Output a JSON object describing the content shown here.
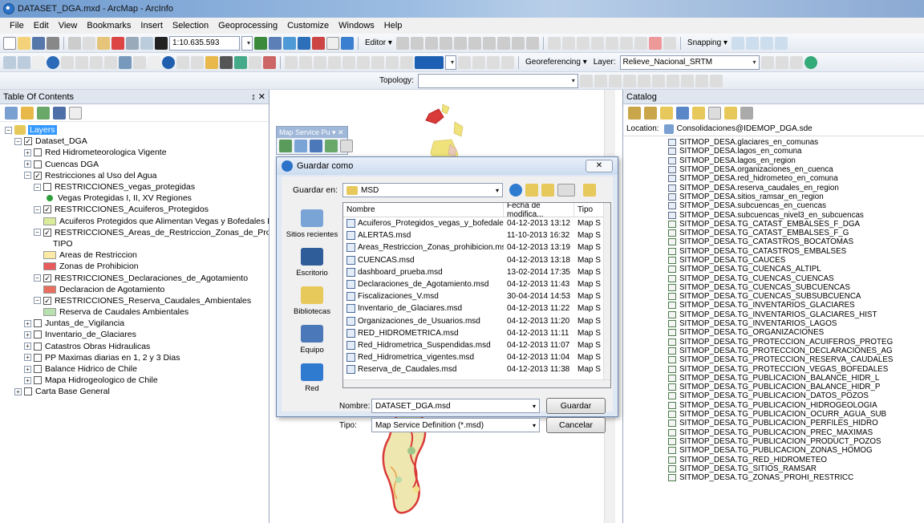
{
  "window": {
    "title": "DATASET_DGA.mxd - ArcMap - ArcInfo"
  },
  "menu": [
    "File",
    "Edit",
    "View",
    "Bookmarks",
    "Insert",
    "Selection",
    "Geoprocessing",
    "Customize",
    "Windows",
    "Help"
  ],
  "toolbar": {
    "scale": "1:10.635.593",
    "editor_label": "Editor ▾",
    "snapping_label": "Snapping ▾",
    "georef_label": "Georeferencing ▾",
    "layer_label": "Layer:",
    "layer_value": "Relieve_Nacional_SRTM",
    "topology_label": "Topology:"
  },
  "toc": {
    "title": "Table Of Contents",
    "pin": "↕ ✕",
    "rows": [
      {
        "indent": 0,
        "exp": "−",
        "check": null,
        "text": "Layers",
        "hl": true
      },
      {
        "indent": 1,
        "exp": "−",
        "check": "✓",
        "text": "Dataset_DGA"
      },
      {
        "indent": 2,
        "exp": "+",
        "check": "",
        "text": "Red Hidrometeorologica Vigente"
      },
      {
        "indent": 2,
        "exp": "+",
        "check": "",
        "text": "Cuencas DGA"
      },
      {
        "indent": 2,
        "exp": "−",
        "check": "✓",
        "text": "Restricciones al Uso del Agua"
      },
      {
        "indent": 3,
        "exp": "−",
        "check": "",
        "text": "RESTRICCIONES_vegas_protegidas"
      },
      {
        "indent": 4,
        "sym": "#2e9e3a",
        "text": "Vegas Protegidas I, II, XV Regiones",
        "dot": true
      },
      {
        "indent": 3,
        "exp": "−",
        "check": "✓",
        "text": "RESTRICCIONES_Acuiferos_Protegidos"
      },
      {
        "indent": 4,
        "sym": "#d9ec9a",
        "text": "Acuiferos Protegidos que Alimentan Vegas y Bofedales I, I"
      },
      {
        "indent": 3,
        "exp": "−",
        "check": "✓",
        "text": "RESTRICCIONES_Areas_de_Restriccion_Zonas_de_Prohibicion"
      },
      {
        "indent": 5,
        "text": "TIPO"
      },
      {
        "indent": 4,
        "sym": "#fbe9a6",
        "text": "Areas de Restriccion"
      },
      {
        "indent": 4,
        "sym": "#e85b5b",
        "text": "Zonas de Prohibicion"
      },
      {
        "indent": 3,
        "exp": "−",
        "check": "✓",
        "text": "RESTRICCIONES_Declaraciones_de_Agotamiento"
      },
      {
        "indent": 4,
        "sym": "#e86f5f",
        "text": "Declaracion de Agotamiento"
      },
      {
        "indent": 3,
        "exp": "−",
        "check": "✓",
        "text": "RESTRICCIONES_Reserva_Caudales_Ambientales"
      },
      {
        "indent": 4,
        "sym": "#b9e0b0",
        "text": "Reserva de Caudales Ambientales"
      },
      {
        "indent": 2,
        "exp": "+",
        "check": "",
        "text": "Juntas_de_Vigilancia"
      },
      {
        "indent": 2,
        "exp": "+",
        "check": "",
        "text": "Inventario_de_Glaciares"
      },
      {
        "indent": 2,
        "exp": "+",
        "check": "",
        "text": "Catastros Obras Hidraulicas"
      },
      {
        "indent": 2,
        "exp": "+",
        "check": "",
        "text": "PP Maximas diarias en 1, 2 y 3 Dias"
      },
      {
        "indent": 2,
        "exp": "+",
        "check": "",
        "text": "Balance Hidrico de Chile"
      },
      {
        "indent": 2,
        "exp": "+",
        "check": "",
        "text": "Mapa Hidrogeologico de Chile"
      },
      {
        "indent": 1,
        "exp": "+",
        "check": "",
        "text": "Carta Base General"
      }
    ]
  },
  "map_service_palette": {
    "title": "Map Service Pu ▾ ✕"
  },
  "dialog": {
    "title": "Guardar como",
    "close": "✕",
    "save_in_label": "Guardar en:",
    "save_in_value": "MSD",
    "places": [
      "Sitios recientes",
      "Escritorio",
      "Bibliotecas",
      "Equipo",
      "Red"
    ],
    "columns": [
      "Nombre",
      "Fecha de modifica...",
      "Tipo"
    ],
    "files": [
      {
        "name": "Acuiferos_Protegidos_vegas_y_bofedales.msd",
        "date": "04-12-2013 13:12",
        "type": "Map S"
      },
      {
        "name": "ALERTAS.msd",
        "date": "11-10-2013 16:32",
        "type": "Map S"
      },
      {
        "name": "Areas_Restriccion_Zonas_prohibicion.msd",
        "date": "04-12-2013 13:19",
        "type": "Map S"
      },
      {
        "name": "CUENCAS.msd",
        "date": "04-12-2013 13:18",
        "type": "Map S"
      },
      {
        "name": "dashboard_prueba.msd",
        "date": "13-02-2014 17:35",
        "type": "Map S"
      },
      {
        "name": "Declaraciones_de_Agotamiento.msd",
        "date": "04-12-2013 11:43",
        "type": "Map S"
      },
      {
        "name": "Fiscalizaciones_V.msd",
        "date": "30-04-2014 14:53",
        "type": "Map S"
      },
      {
        "name": "Inventario_de_Glaciares.msd",
        "date": "04-12-2013 11:22",
        "type": "Map S"
      },
      {
        "name": "Organizaciones_de_Usuarios.msd",
        "date": "04-12-2013 11:20",
        "type": "Map S"
      },
      {
        "name": "RED_HIDROMETRICA.msd",
        "date": "04-12-2013 11:11",
        "type": "Map S"
      },
      {
        "name": "Red_Hidrometrica_Suspendidas.msd",
        "date": "04-12-2013 11:07",
        "type": "Map S"
      },
      {
        "name": "Red_Hidrometrica_vigentes.msd",
        "date": "04-12-2013 11:04",
        "type": "Map S"
      },
      {
        "name": "Reserva_de_Caudales.msd",
        "date": "04-12-2013 11:38",
        "type": "Map S"
      }
    ],
    "filename_label": "Nombre:",
    "filename_value": "DATASET_DGA.msd",
    "type_label": "Tipo:",
    "type_value": "Map Service Definition (*.msd)",
    "save_button": "Guardar",
    "cancel_button": "Cancelar"
  },
  "catalog": {
    "title": "Catalog",
    "location_label": "Location:",
    "location_value": "Consolidaciones@IDEMOP_DGA.sde",
    "items": [
      "SITMOP_DESA.glaciares_en_comunas",
      "SITMOP_DESA.lagos_en_comuna",
      "SITMOP_DESA.lagos_en_region",
      "SITMOP_DESA.organizaciones_en_cuenca",
      "SITMOP_DESA.red_hidrometeo_en_comuna",
      "SITMOP_DESA.reserva_caudales_en_region",
      "SITMOP_DESA.sitios_ramsar_en_region",
      "SITMOP_DESA.subcuencas_en_cuencas",
      "SITMOP_DESA.subcuencas_nivel3_en_subcuencas",
      "SITMOP_DESA.TG_CATAST_EMBALSES_F_DGA",
      "SITMOP_DESA.TG_CATAST_EMBALSES_F_G",
      "SITMOP_DESA.TG_CATASTROS_BOCATOMAS",
      "SITMOP_DESA.TG_CATASTROS_EMBALSES",
      "SITMOP_DESA.TG_CAUCES",
      "SITMOP_DESA.TG_CUENCAS_ALTIPL",
      "SITMOP_DESA.TG_CUENCAS_CUENCAS",
      "SITMOP_DESA.TG_CUENCAS_SUBCUENCAS",
      "SITMOP_DESA.TG_CUENCAS_SUBSUBCUENCA",
      "SITMOP_DESA.TG_INVENTARIOS_GLACIARES",
      "SITMOP_DESA.TG_INVENTARIOS_GLACIARES_HIST",
      "SITMOP_DESA.TG_INVENTARIOS_LAGOS",
      "SITMOP_DESA.TG_ORGANIZACIONES",
      "SITMOP_DESA.TG_PROTECCION_ACUIFEROS_PROTEG",
      "SITMOP_DESA.TG_PROTECCION_DECLARACIONES_AG",
      "SITMOP_DESA.TG_PROTECCION_RESERVA_CAUDALES",
      "SITMOP_DESA.TG_PROTECCION_VEGAS_BOFEDALES",
      "SITMOP_DESA.TG_PUBLICACION_BALANCE_HIDR_L",
      "SITMOP_DESA.TG_PUBLICACION_BALANCE_HIDR_P",
      "SITMOP_DESA.TG_PUBLICACION_DATOS_POZOS",
      "SITMOP_DESA.TG_PUBLICACION_HIDROGEOLOGIA",
      "SITMOP_DESA.TG_PUBLICACION_OCURR_AGUA_SUB",
      "SITMOP_DESA.TG_PUBLICACION_PERFILES_HIDRO",
      "SITMOP_DESA.TG_PUBLICACION_PREC_MAXIMAS",
      "SITMOP_DESA.TG_PUBLICACION_PRODUCT_POZOS",
      "SITMOP_DESA.TG_PUBLICACION_ZONAS_HOMOG",
      "SITMOP_DESA.TG_RED_HIDROMETEO",
      "SITMOP_DESA.TG_SITIOS_RAMSAR",
      "SITMOP_DESA.TG_ZONAS_PROHI_RESTRICC"
    ]
  },
  "colors": {
    "titlebar": "#6f9bd0",
    "selection": "#3399ff",
    "map_red": "#d93a3a",
    "map_yellow": "#efe27a"
  }
}
